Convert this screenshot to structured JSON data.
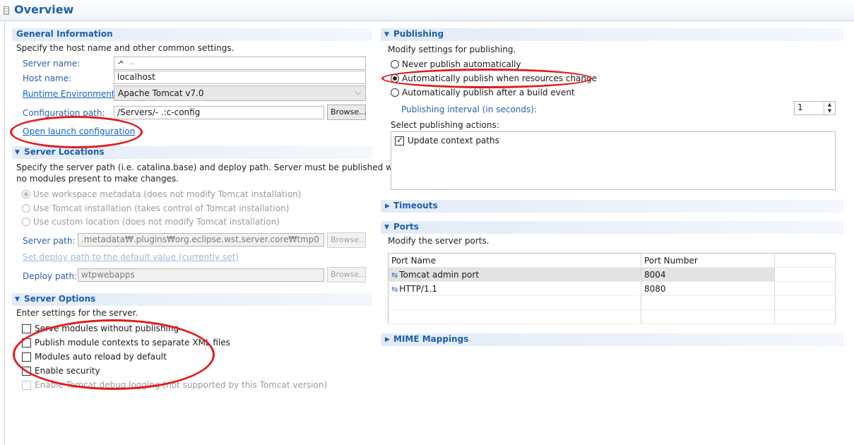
{
  "header": {
    "title": "Overview"
  },
  "general": {
    "title": "General Information",
    "description": "Specify the host name and other common settings.",
    "server_name_label": "Server name:",
    "server_name_value": "ᄼ ᆢ",
    "host_name_label": "Host name:",
    "host_name_value": "localhost",
    "runtime_label": "Runtime Environment:",
    "runtime_value": "Apache Tomcat v7.0",
    "config_path_label": "Configuration path:",
    "config_path_value": "/Servers/-  .:c-config",
    "browse_label": "Browse...",
    "open_launch_label": "Open launch configuration"
  },
  "server_locations": {
    "title": "Server Locations",
    "description_1": "Specify the server path (i.e. catalina.base) and deploy path. Server must be published with",
    "description_2": "no modules present to make changes.",
    "options": [
      "Use workspace metadata (does not modify Tomcat installation)",
      "Use Tomcat installation (takes control of Tomcat installation)",
      "Use custom location (does not modify Tomcat installation)"
    ],
    "server_path_label": "Server path:",
    "server_path_value": ".metadata₩.plugins₩org.eclipse.wst.server.core₩tmp0",
    "browse_label": "Browse...",
    "set_deploy_link": "Set deploy path to the default value (currently set)",
    "deploy_path_label": "Deploy path:",
    "deploy_path_value": "wtpwebapps"
  },
  "server_options": {
    "title": "Server Options",
    "description": "Enter settings for the server.",
    "options": [
      "Serve modules without publishing",
      "Publish module contexts to separate XML files",
      "Modules auto reload by default",
      "Enable security",
      "Enable Tomcat debug logging (not supported by this Tomcat version)"
    ]
  },
  "publishing": {
    "title": "Publishing",
    "description": "Modify settings for publishing.",
    "options": [
      "Never publish automatically",
      "Automatically publish when resources change",
      "Automatically publish after a build event"
    ],
    "interval_label": "Publishing interval (in seconds):",
    "interval_value": "1",
    "actions_label": "Select publishing actions:",
    "actions": [
      "Update context paths"
    ]
  },
  "timeouts": {
    "title": "Timeouts"
  },
  "ports": {
    "title": "Ports",
    "description": "Modify the server ports.",
    "columns": [
      "Port Name",
      "Port Number"
    ],
    "rows": [
      {
        "name": "Tomcat admin port",
        "number": "8004"
      },
      {
        "name": "HTTP/1.1",
        "number": "8080"
      }
    ]
  },
  "mime": {
    "title": "MIME Mappings"
  },
  "colors": {
    "accent": "#1f5fa8",
    "link": "#0e62c5",
    "annotation": "#e31b1b"
  }
}
